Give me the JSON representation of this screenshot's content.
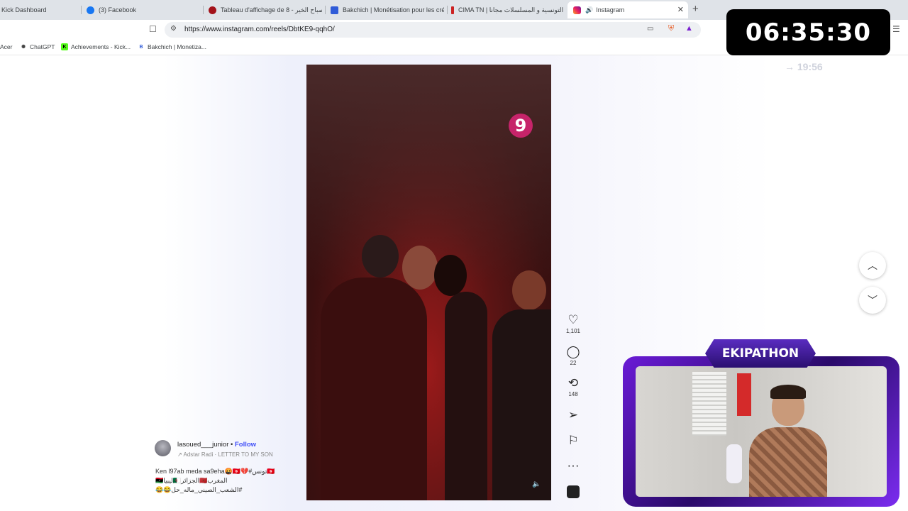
{
  "browser": {
    "tabs": [
      {
        "title": "Kick Dashboard",
        "active": false
      },
      {
        "title": "(3) Facebook",
        "active": false
      },
      {
        "title": "Tableau d'affichage de صباح الخير - 8",
        "active": false
      },
      {
        "title": "Bakchich | Monétisation pour les cré",
        "active": false
      },
      {
        "title": "CIMA TN | التونسية و المسلسلات مجانا",
        "active": false
      },
      {
        "title": "Instagram",
        "active": true
      }
    ],
    "url": "https://www.instagram.com/reels/DbtKE9-qqhO/",
    "bookmarks": [
      "Acer",
      "ChatGPT",
      "Achievements - Kick...",
      "Bakchich | Monetiza..."
    ],
    "colors": {
      "tabbar": "#dfe3e8",
      "instagram_blue": "#4150f7"
    }
  },
  "reel": {
    "username": "lasoued___junior",
    "separator": "•",
    "follow_label": "Follow",
    "audio": "Adstar Radi · LETTER TO MY SON",
    "caption_lines": [
      "Ken l97ab meda sa9eha🤬🇹🇳💔#تونس🇹🇳",
      "المغرب🇲🇦الجزائر🇩🇿ليبيا🇱🇾",
      "#الشعب_الصيني_ماله_حل😂😂"
    ],
    "likes": "1,101",
    "comments": "22",
    "reposts": "148",
    "video_logo": "9"
  },
  "overlay": {
    "timer": "06:35:30",
    "subtimer": "→ 19:56",
    "cam_title": "EKIPATHON"
  },
  "icons": {
    "like": "heart-icon",
    "comment": "comment-icon",
    "repost": "repost-icon",
    "share": "share-icon",
    "save": "bookmark-icon",
    "more": "more-icon"
  }
}
